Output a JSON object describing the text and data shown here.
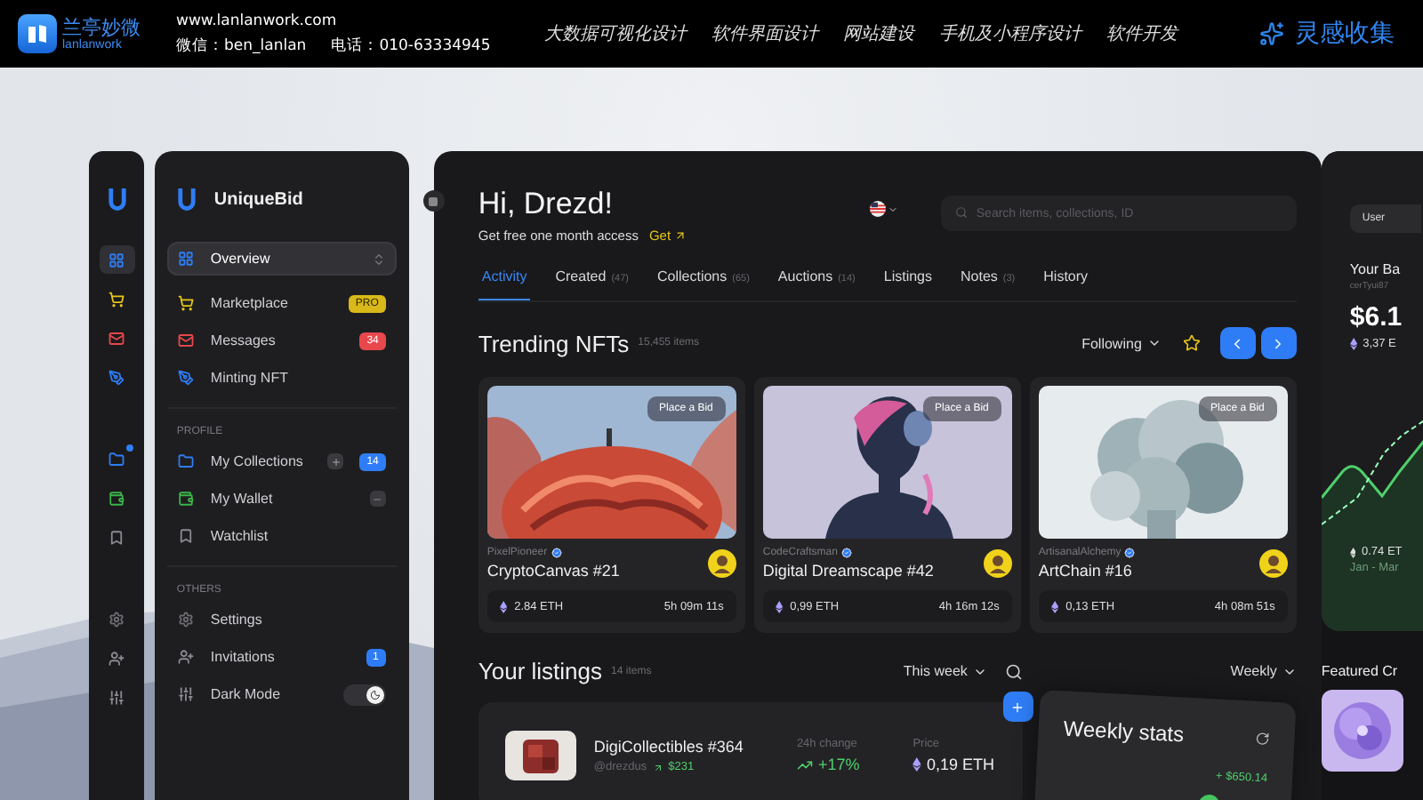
{
  "header": {
    "brand": "兰亭妙微",
    "brand_sub": "lanlanwork",
    "url": "www.lanlanwork.com",
    "wechat": "微信：ben_lanlan",
    "phone": "电话：010-63334945",
    "nav": [
      "大数据可视化设计",
      "软件界面设计",
      "网站建设",
      "手机及小程序设计",
      "软件开发"
    ],
    "cta": "灵感收集"
  },
  "rail": {
    "groups": [
      {
        "items": [
          {
            "selected": true,
            "dot": false
          },
          {
            "selected": false,
            "dot": false
          },
          {
            "selected": false,
            "dot": false
          },
          {
            "selected": false,
            "dot": false
          }
        ]
      },
      {
        "items": [
          {
            "selected": false,
            "dot": true
          },
          {
            "selected": false,
            "dot": false
          },
          {
            "selected": false,
            "dot": false
          }
        ]
      },
      {
        "items": [
          {
            "selected": false,
            "dot": false
          },
          {
            "selected": false,
            "dot": false
          },
          {
            "selected": false,
            "dot": false
          }
        ]
      }
    ]
  },
  "sidebar": {
    "brand": "UniqueBid",
    "sections": [
      {
        "items": [
          {
            "label": "Overview",
            "selected": true,
            "kind": "handle"
          },
          {
            "label": "Marketplace",
            "selected": false,
            "kind": "badge",
            "badge": "PRO",
            "color": "#d9b81a"
          },
          {
            "label": "Messages",
            "selected": false,
            "kind": "badge",
            "badge": "34",
            "color": "#e8474c"
          },
          {
            "label": "Minting NFT",
            "selected": false,
            "kind": "plain"
          }
        ]
      },
      {
        "title": "PROFILE",
        "items": [
          {
            "label": "My Collections",
            "selected": false,
            "kind": "add-badge",
            "badge": "14",
            "color": "#2f7df6"
          },
          {
            "label": "My Wallet",
            "selected": false,
            "kind": "minus"
          },
          {
            "label": "Watchlist",
            "selected": false,
            "kind": "plain"
          }
        ]
      },
      {
        "title": "OTHERS",
        "items": [
          {
            "label": "Settings",
            "selected": false,
            "kind": "plain"
          },
          {
            "label": "Invitations",
            "selected": false,
            "kind": "badge",
            "badge": "1",
            "color": "#2f7df6"
          },
          {
            "label": "Dark Mode",
            "selected": false,
            "kind": "toggle",
            "on": true
          }
        ]
      }
    ]
  },
  "main": {
    "greeting": "Hi, Drezd!",
    "promo": "Get free one month access",
    "promo_link": "Get",
    "search": {
      "placeholder": "Search items, collections, ID"
    },
    "tabs": [
      {
        "label": "Activity",
        "selected": true
      },
      {
        "label": "Created",
        "count": "(47)",
        "selected": false
      },
      {
        "label": "Collections",
        "count": "(65)",
        "selected": false
      },
      {
        "label": "Auctions",
        "count": "(14)",
        "selected": false
      },
      {
        "label": "Listings",
        "selected": false
      },
      {
        "label": "Notes",
        "count": "(3)",
        "selected": false
      },
      {
        "label": "History",
        "selected": false
      }
    ],
    "trending": {
      "title": "Trending NFTs",
      "count": "15,455 items",
      "filter": "Following",
      "cards": [
        {
          "creator": "PixelPioneer",
          "verified": true,
          "title": "CryptoCanvas #21",
          "price": "2.84 ETH",
          "time": "5h 09m 11s",
          "button": "Place a Bid"
        },
        {
          "creator": "CodeCraftsman",
          "verified": true,
          "title": "Digital Dreamscape #42",
          "price": "0,99 ETH",
          "time": "4h 16m 12s",
          "button": "Place a Bid"
        },
        {
          "creator": "ArtisanalAlchemy",
          "verified": true,
          "title": "ArtChain #16",
          "price": "0,13 ETH",
          "time": "4h 08m 51s",
          "button": "Place a Bid"
        }
      ]
    },
    "listings": {
      "title": "Your listings",
      "count": "14 items",
      "filter": "This week",
      "rows": [
        {
          "name": "DigiCollectibles #364",
          "handle": "@drezdus",
          "gain": "$231",
          "change_label": "24h change",
          "change": "+17%",
          "price_label": "Price",
          "price": "0,19 ETH"
        }
      ]
    },
    "weekly": {
      "filter": "Weekly",
      "title": "Weekly stats",
      "value": "+ $650.14"
    }
  },
  "right": {
    "tab": "User",
    "title": "Your Ba",
    "address": "cerTyui87",
    "balance": "$6.1",
    "eth": "3,37 E",
    "chart_eth": "0.74 ET",
    "chart_range": "Jan - Mar",
    "featured": "Featured Cr"
  }
}
